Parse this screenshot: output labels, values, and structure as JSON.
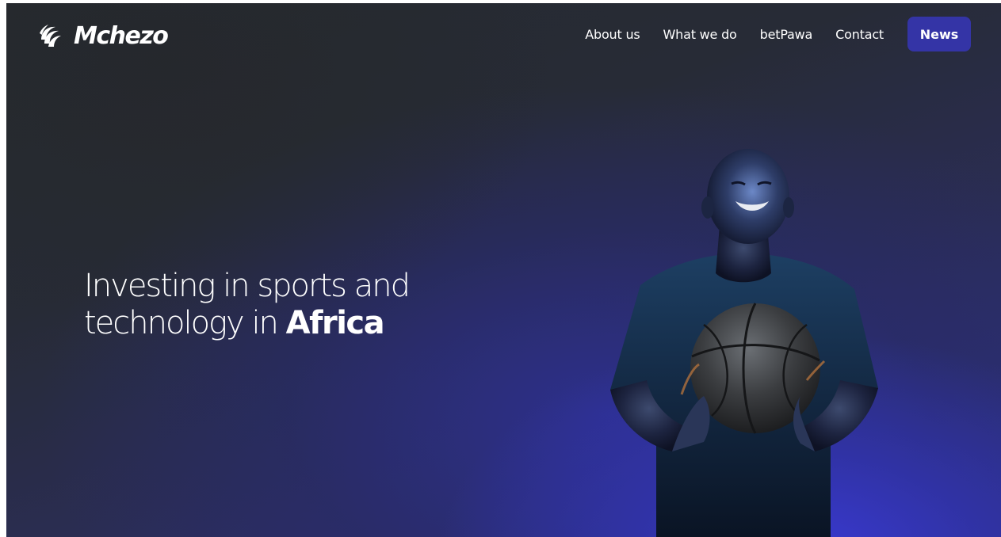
{
  "brand": {
    "name": "Mchezo",
    "logo_icon": "swirl-ball-icon"
  },
  "nav": {
    "items": [
      {
        "label": "About us"
      },
      {
        "label": "What we do"
      },
      {
        "label": "betPawa"
      },
      {
        "label": "Contact"
      }
    ],
    "cta_label": "News"
  },
  "hero": {
    "headline_line1": "Investing in sports and",
    "headline_line2_prefix": "technology in ",
    "headline_line2_bold": "Africa",
    "image": "athlete-holding-basketball-photo"
  },
  "colors": {
    "accent": "#3434a6",
    "background_dark": "#262a2f",
    "background_glow": "#3a3ad7",
    "text": "#ffffff"
  }
}
